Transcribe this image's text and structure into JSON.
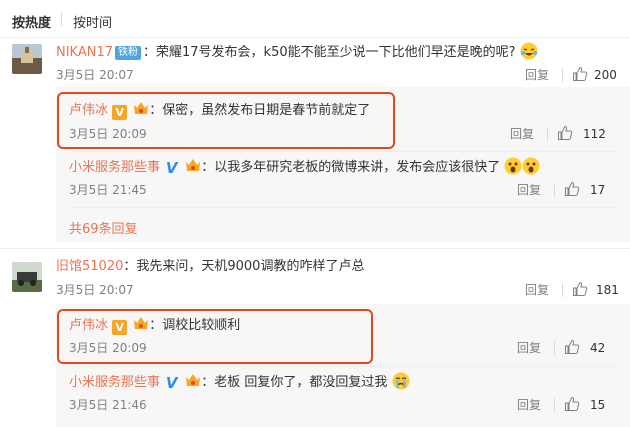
{
  "sort": {
    "hot": "按热度",
    "time": "按时间"
  },
  "actions": {
    "reply": "回复"
  },
  "comments": [
    {
      "user": "NIKAN17",
      "badge": "铁粉",
      "text": "：荣耀17号发布会，k50能不能至少说一下比他们早还是晚的呢?",
      "time": "3月5日 20:07",
      "likes": "200",
      "replies": [
        {
          "user": "卢伟冰",
          "text": "：保密，虽然发布日期是春节前就定了",
          "time": "3月5日 20:09",
          "likes": "112"
        },
        {
          "user": "小米服务那些事",
          "text": "：以我多年研究老板的微博来讲，发布会应该很快了",
          "time": "3月5日 21:45",
          "likes": "17"
        }
      ],
      "more_replies": "共69条回复"
    },
    {
      "user": "旧馆51020",
      "text": "：我先来问，天机9000调教的咋样了卢总",
      "time": "3月5日 20:07",
      "likes": "181",
      "replies": [
        {
          "user": "卢伟冰",
          "text": "：调校比较顺利",
          "time": "3月5日 20:09",
          "likes": "42"
        },
        {
          "user": "小米服务那些事",
          "text": "：老板 回复你了，都没回复过我",
          "time": "3月5日 21:46",
          "likes": "15"
        }
      ]
    }
  ],
  "colors": {
    "username": "#eb7350",
    "highlight_box": "#e8471e",
    "reply_bg": "#f7f7f7",
    "fan_badge": "#4fa6e0",
    "v_gold": "#f5a623",
    "v_blue": "#2a8ff0"
  }
}
